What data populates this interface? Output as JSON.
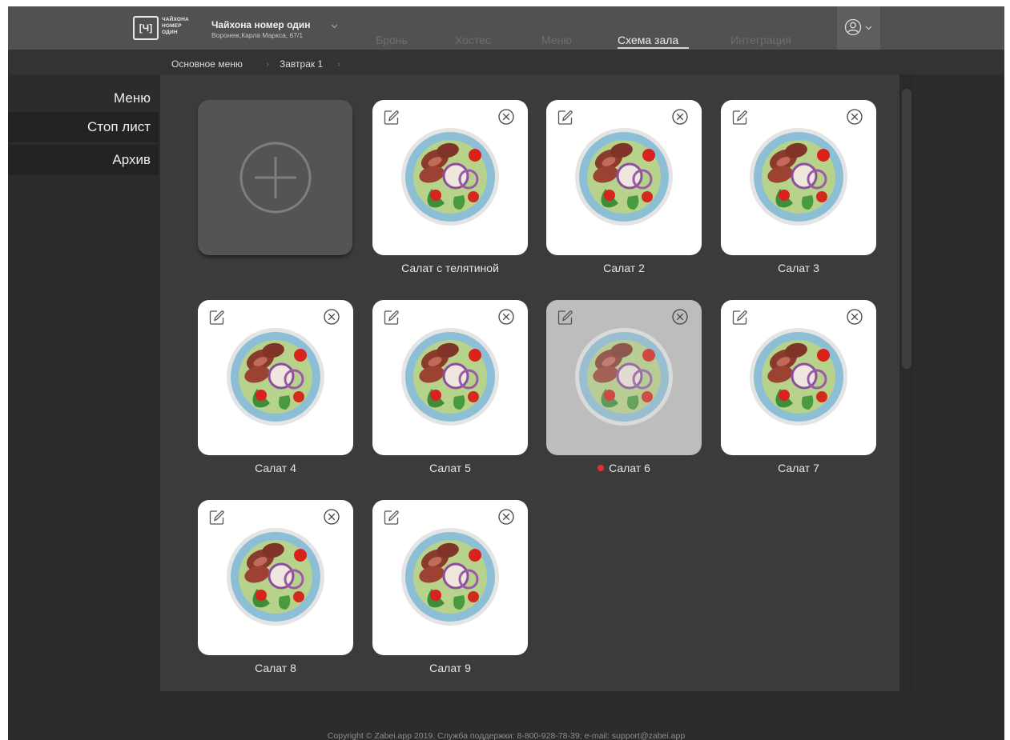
{
  "header": {
    "logo_lines": [
      "ЧАЙХОНА",
      "НОМЕР",
      "ОДИН"
    ],
    "logo_mark": "[Ч]",
    "org_name": "Чайхона номер один",
    "org_address": "Воронеж,Карла Маркса, 67/1",
    "nav": [
      {
        "label": "Бронь",
        "active": false
      },
      {
        "label": "Хостес",
        "active": false
      },
      {
        "label": "Меню",
        "active": false
      },
      {
        "label": "Схема зала",
        "active": true
      },
      {
        "label": "Интеграция",
        "active": false
      }
    ],
    "profile_icon": "user-circle-icon"
  },
  "breadcrumb": [
    "Основное меню",
    "Завтрак 1"
  ],
  "sidebar": {
    "items": [
      {
        "label": "Меню",
        "selected": true
      },
      {
        "label": "Стоп лист",
        "selected": false
      },
      {
        "label": "Архив",
        "selected": false
      }
    ]
  },
  "grid": {
    "add_icon": "plus-circle-icon",
    "items": [
      {
        "name": "Салат с телятиной",
        "stopped": false
      },
      {
        "name": "Салат 2",
        "stopped": false
      },
      {
        "name": "Салат 3",
        "stopped": false
      },
      {
        "name": "Салат 4",
        "stopped": false
      },
      {
        "name": "Салат 5",
        "stopped": false
      },
      {
        "name": "Салат 6",
        "stopped": true
      },
      {
        "name": "Салат 7",
        "stopped": false
      },
      {
        "name": "Салат 8",
        "stopped": false
      },
      {
        "name": "Салат 9",
        "stopped": false
      }
    ]
  },
  "colors": {
    "stop_indicator": "#e23030",
    "accent_underline": "#d5d5d5"
  },
  "footer": "Copyright © Zabei.app 2019. Служба поддержки: 8-800-928-78-39; e-mail: support@zabei.app"
}
